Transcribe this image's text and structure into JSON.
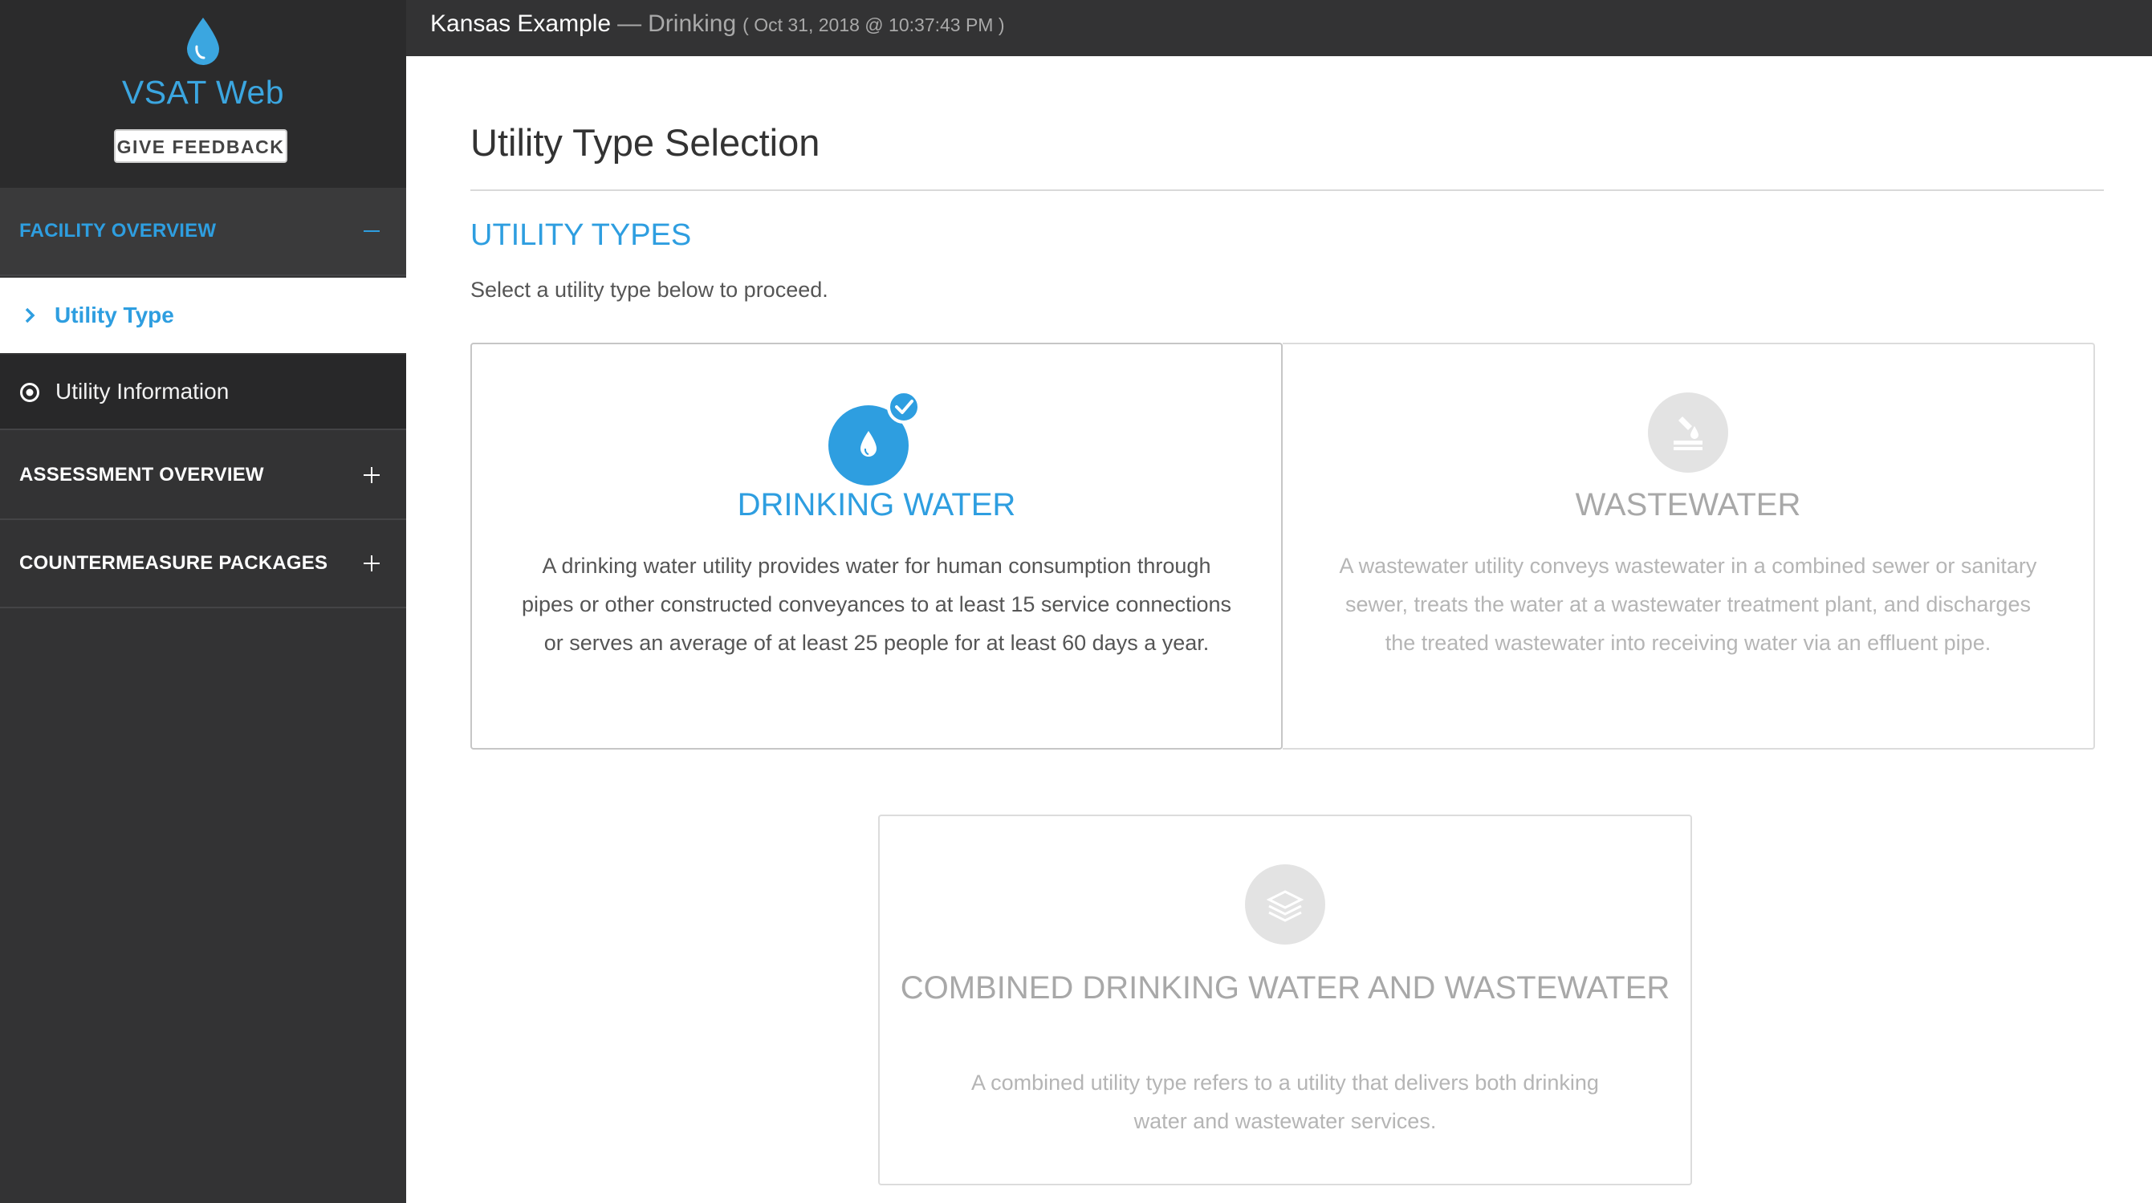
{
  "app": {
    "name": "VSAT Web",
    "feedback_label": "GIVE FEEDBACK"
  },
  "sidebar": {
    "sections": [
      {
        "label": "FACILITY OVERVIEW",
        "expanded": true,
        "items": [
          {
            "label": "Utility Type",
            "active": true,
            "icon": "chevron-right-icon"
          },
          {
            "label": "Utility Information",
            "active": false,
            "icon": "radio-target-icon"
          }
        ]
      },
      {
        "label": "ASSESSMENT OVERVIEW",
        "expanded": false
      },
      {
        "label": "COUNTERMEASURE PACKAGES",
        "expanded": false
      }
    ]
  },
  "header": {
    "facility": "Kansas Example",
    "separator": "—",
    "assessment_type": "Drinking",
    "timestamp": "( Oct 31, 2018 @ 10:37:43 PM )"
  },
  "main": {
    "page_title": "Utility Type Selection",
    "section_title": "UTILITY TYPES",
    "instruction": "Select a utility type below to proceed.",
    "cards": [
      {
        "title": "DRINKING WATER",
        "description": "A drinking water utility provides water for human consumption through pipes or other constructed conveyances to at least 15 service connections or serves an average of at least 25 people for at least 60 days a year.",
        "selected": true,
        "icon": "water-drop-icon"
      },
      {
        "title": "WASTEWATER",
        "description": "A wastewater utility conveys wastewater in a combined sewer or sanitary sewer, treats the water at a wastewater treatment plant, and discharges the treated wastewater into receiving water via an effluent pipe.",
        "selected": false,
        "icon": "wastewater-icon"
      },
      {
        "title": "COMBINED DRINKING WATER AND WASTEWATER",
        "description": "A combined utility type refers to a utility that delivers both drinking water and wastewater services.",
        "selected": false,
        "icon": "layers-icon"
      }
    ]
  },
  "colors": {
    "accent": "#2e9ee0",
    "sidebar_bg": "#333334",
    "disabled_text": "#a8a8a8"
  }
}
